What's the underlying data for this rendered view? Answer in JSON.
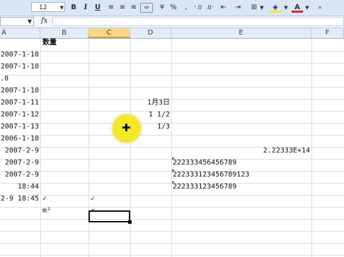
{
  "toolbar": {
    "font_size": "12",
    "bold_label": "B",
    "italic_label": "I",
    "underline_label": "U",
    "percent_label": "%"
  },
  "formula_bar": {
    "fx_label": "fx",
    "value": ""
  },
  "columns": [
    "A",
    "B",
    "C",
    "D",
    "E",
    "F"
  ],
  "selected_column": "C",
  "cells": {
    "b_header": "数量",
    "a": [
      "2007-1-10",
      "2007-1-10",
      ".0",
      "2007-1-10",
      "2007-1-11",
      "2007-1-12",
      "2007-1-13",
      "2006-1-10",
      "2007-2-9",
      "2007-2-9",
      "2007-2-9",
      "18:44",
      "2-9 18:45"
    ],
    "d": [
      "1月3日",
      "1 1/2",
      "1/3"
    ],
    "e_sci": "2.22333E+14",
    "e_text": [
      "222333456456789",
      "222333123456789123",
      "222333123456789"
    ],
    "b_check": "✓",
    "c_check": "✓",
    "b_sup": "m²",
    "c_cross": "×"
  },
  "colors": {
    "toolbar_bg": "#dbe6f4",
    "header_bg": "#e4ecf7",
    "selected_header": "#f8d78a",
    "highlight": "#f3e72a",
    "error_triangle": "#2e8b3d"
  }
}
